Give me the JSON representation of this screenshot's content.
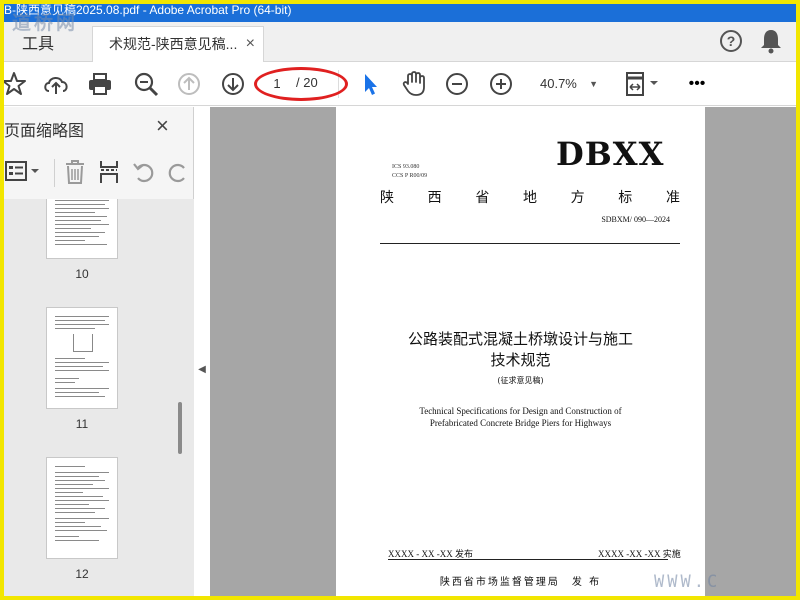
{
  "window": {
    "title": "B-陕西意见稿2025.08.pdf - Adobe Acrobat Pro (64-bit)",
    "watermark_text": "道桥网",
    "corner_watermark": "WWW.C"
  },
  "tabs": {
    "tools_label": "工具",
    "document_label": "术规范-陕西意见稿...",
    "close_glyph": "×",
    "help_glyph": "?"
  },
  "toolbar": {
    "current_page": "1",
    "total_pages": "/ 20",
    "zoom": "40.7%",
    "more_glyph": "•••"
  },
  "thumbnail_pane": {
    "title": "页面缩略图",
    "close_glyph": "×",
    "pages": [
      {
        "number": "10"
      },
      {
        "number": "11"
      },
      {
        "number": "12"
      }
    ]
  },
  "document": {
    "ics": "ICS 93.080",
    "ccs": "CCS P R00/09",
    "standard_badge": "DBXX",
    "standard_type_chars": [
      "陕",
      "西",
      "省",
      "地",
      "方",
      "标",
      "准"
    ],
    "standard_code": "SDBXM/ 090—2024",
    "title_cn_line1": "公路装配式混凝土桥墩设计与施工",
    "title_cn_line2": "技术规范",
    "draft_note": "(征求意见稿)",
    "title_en_line1": "Technical Specifications for Design and Construction of",
    "title_en_line2": "Prefabricated Concrete Bridge Piers for Highways",
    "publish_date": "XXXX - XX -XX 发布",
    "effective_date": "XXXX -XX -XX 实施",
    "issuer": "陕西省市场监督管理局　发 布"
  },
  "colors": {
    "titlebar": "#1b6fd8",
    "frame": "#f2e600",
    "annotation_circle": "#e02020",
    "select_tool": "#1a73e8",
    "canvas": "#a6a6a6"
  }
}
